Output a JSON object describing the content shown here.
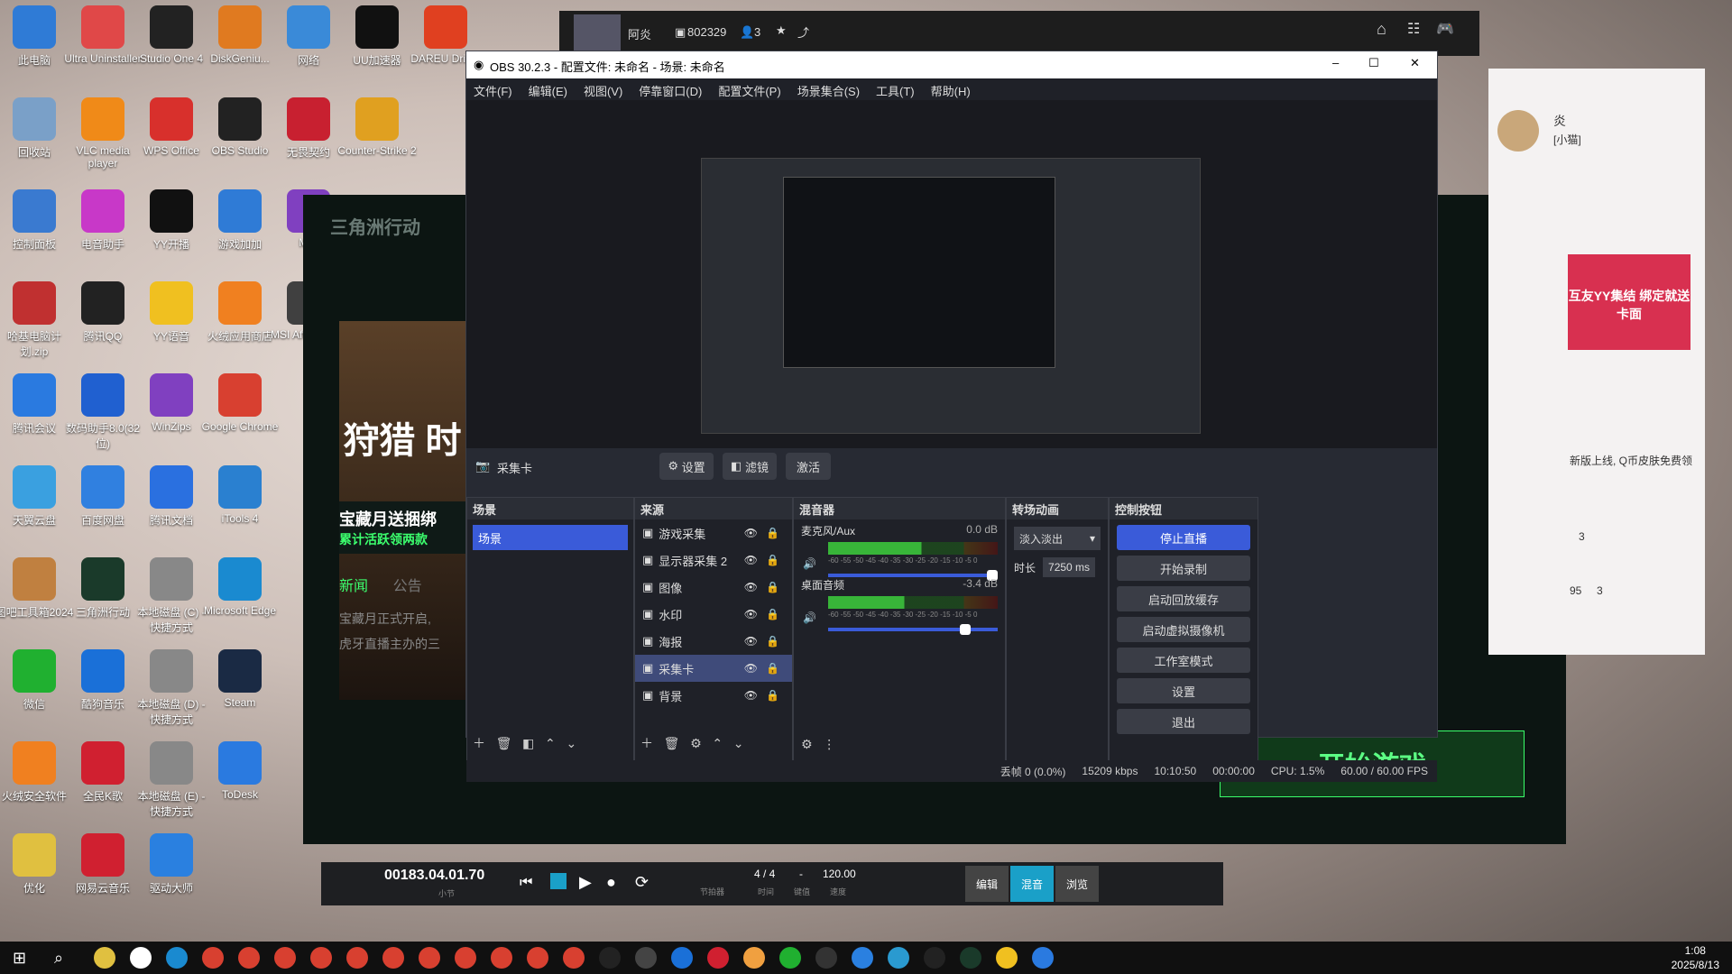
{
  "desktop": {
    "icons": [
      {
        "label": "此电脑",
        "color": "#2f7bd6"
      },
      {
        "label": "Ultra Uninstaller",
        "color": "#e04848"
      },
      {
        "label": "Studio One 4",
        "color": "#222"
      },
      {
        "label": "DiskGeniu...",
        "color": "#e07a20"
      },
      {
        "label": "网络",
        "color": "#3a8ad8"
      },
      {
        "label": "UU加速器",
        "color": "#111"
      },
      {
        "label": "DAREU Driver",
        "color": "#e04020"
      },
      {
        "label": "回收站",
        "color": "#7aa0c8"
      },
      {
        "label": "VLC media player",
        "color": "#f08a18"
      },
      {
        "label": "WPS Office",
        "color": "#d8302c"
      },
      {
        "label": "OBS Studio",
        "color": "#222"
      },
      {
        "label": "无畏契约",
        "color": "#c82030"
      },
      {
        "label": "Counter-Strike 2",
        "color": "#e0a020"
      },
      {
        "label": "控制面板",
        "color": "#3a7ad0"
      },
      {
        "label": "电音助手",
        "color": "#c838c8"
      },
      {
        "label": "YY开播",
        "color": "#111"
      },
      {
        "label": "游戏加加",
        "color": "#2f7bd6"
      },
      {
        "label": "MSI",
        "color": "#8040c0"
      },
      {
        "label": "哈基电脑计划.zip",
        "color": "#c03030"
      },
      {
        "label": "腾讯QQ",
        "color": "#222"
      },
      {
        "label": "YY语音",
        "color": "#f0c020"
      },
      {
        "label": "火绒应用商店",
        "color": "#f08020"
      },
      {
        "label": "MSI Afterburner",
        "color": "#404040"
      },
      {
        "label": "腾讯会议",
        "color": "#2a7ae0"
      },
      {
        "label": "数码助手8.0(32位)",
        "color": "#2060d0"
      },
      {
        "label": "WinZips",
        "color": "#8040c0"
      },
      {
        "label": "Google Chrome",
        "color": "#d84030"
      },
      {
        "label": "天翼云盘",
        "color": "#3aa0e0"
      },
      {
        "label": "百度网盘",
        "color": "#3080e0"
      },
      {
        "label": "腾讯文档",
        "color": "#2a70e0"
      },
      {
        "label": "iTools 4",
        "color": "#2a80d0"
      },
      {
        "label": "图吧工具箱2024",
        "color": "#c08040"
      },
      {
        "label": "三角洲行动",
        "color": "#1a3a2a"
      },
      {
        "label": "本地磁盘 (C) - 快捷方式",
        "color": "#888"
      },
      {
        "label": "Microsoft Edge",
        "color": "#1a8ad0"
      },
      {
        "label": "微信",
        "color": "#20b030"
      },
      {
        "label": "酷狗音乐",
        "color": "#1a70d8"
      },
      {
        "label": "本地磁盘 (D) - 快捷方式",
        "color": "#888"
      },
      {
        "label": "Steam",
        "color": "#1a2a44"
      },
      {
        "label": "火绒安全软件",
        "color": "#f08020"
      },
      {
        "label": "全民K歌",
        "color": "#d02030"
      },
      {
        "label": "本地磁盘 (E) - 快捷方式",
        "color": "#888"
      },
      {
        "label": "ToDesk",
        "color": "#2a7ae0"
      },
      {
        "label": "优化",
        "color": "#e0c040"
      },
      {
        "label": "网易云音乐",
        "color": "#d02030"
      },
      {
        "label": "驱动大师",
        "color": "#2a80e0"
      }
    ]
  },
  "stream_bar": {
    "name": "阿炎",
    "room_id": "802329",
    "viewers": "3"
  },
  "obs": {
    "title": "OBS 30.2.3 - 配置文件: 未命名 - 场景: 未命名",
    "menu": [
      "文件(F)",
      "编辑(E)",
      "视图(V)",
      "停靠窗口(D)",
      "配置文件(P)",
      "场景集合(S)",
      "工具(T)",
      "帮助(H)"
    ],
    "source_bar": {
      "label": "采集卡",
      "settings": "设置",
      "filters": "滤镜",
      "activate": "激活"
    },
    "scenes": {
      "title": "场景",
      "items": [
        "场景"
      ]
    },
    "sources": {
      "title": "来源",
      "items": [
        {
          "label": "游戏采集"
        },
        {
          "label": "显示器采集 2"
        },
        {
          "label": "图像"
        },
        {
          "label": "水印"
        },
        {
          "label": "海报"
        },
        {
          "label": "采集卡"
        },
        {
          "label": "背景"
        }
      ]
    },
    "mixer": {
      "title": "混音器",
      "channels": [
        {
          "name": "麦克风/Aux",
          "db": "0.0 dB",
          "level": 0.55
        },
        {
          "name": "桌面音频",
          "db": "-3.4 dB",
          "level": 0.45
        }
      ],
      "scale": "-60 -55 -50 -45 -40 -35 -30 -25 -20 -15 -10 -5 0"
    },
    "transitions": {
      "title": "转场动画",
      "selected": "淡入淡出",
      "duration_label": "时长",
      "duration": "7250 ms"
    },
    "controls": {
      "title": "控制按钮",
      "buttons": [
        "停止直播",
        "开始录制",
        "启动回放缓存",
        "启动虚拟摄像机",
        "工作室模式",
        "设置",
        "退出"
      ]
    },
    "status": {
      "dropped": "丢帧 0 (0.0%)",
      "bitrate": "15209 kbps",
      "stream_time": "10:10:50",
      "rec_time": "00:00:00",
      "cpu": "CPU: 1.5%",
      "fps": "60.00 / 60.00 FPS"
    }
  },
  "game": {
    "logo": "三角洲行动",
    "banner_title": "狩猎 时",
    "promo_line1": "宝藏月送捆绑",
    "promo_line2": "累计活跃领两款",
    "tabs": [
      "新闻",
      "公告"
    ],
    "news1": "宝藏月正式开启,",
    "news2": "虎牙直播主办的三",
    "start_button": "开始游戏"
  },
  "chat": {
    "name": "炎",
    "subtitle": "[小猫]",
    "promo": "互友YY集结 绑定就送卡面",
    "notice": "新版上线, Q币皮肤免费领",
    "count1": "3",
    "count2": "95",
    "count3": "3"
  },
  "transport": {
    "time": "00183.04.01.70",
    "time_sub": "小节",
    "signature": "4 / 4",
    "signature_sub": "时间",
    "key": "-",
    "key_sub": "键值",
    "tempo": "120.00",
    "tempo_sub": "速度",
    "metronome": "节拍器",
    "tabs": [
      "编辑",
      "混音",
      "浏览"
    ]
  },
  "taskbar": {
    "time": "1:08",
    "date": "2025/8/13"
  }
}
